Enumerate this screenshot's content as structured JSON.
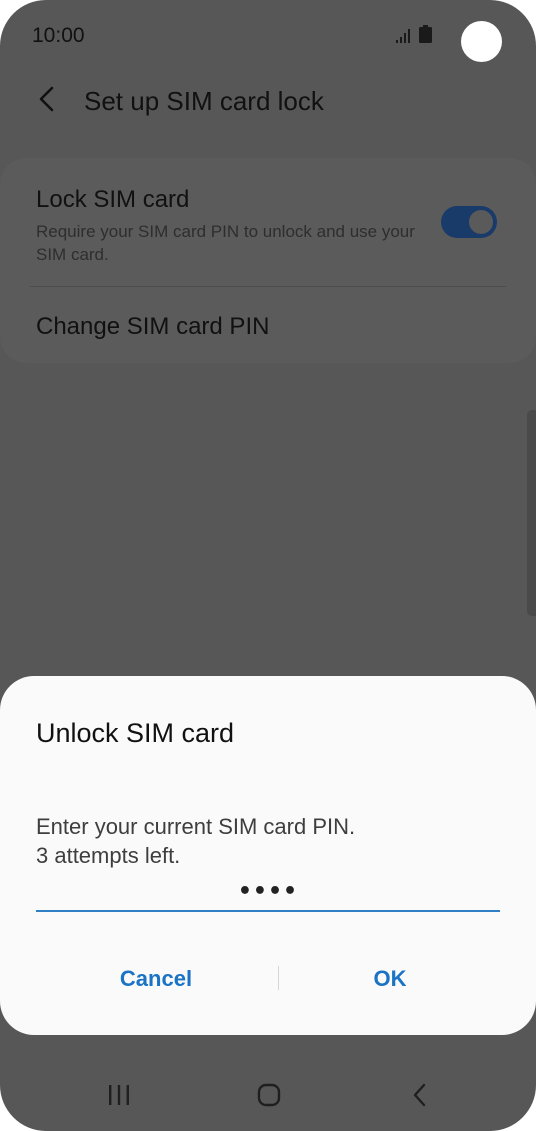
{
  "status_bar": {
    "time": "10:00"
  },
  "header": {
    "title": "Set up SIM card lock"
  },
  "settings": {
    "lock_sim": {
      "title": "Lock SIM card",
      "description": "Require your SIM card PIN to unlock and use your SIM card.",
      "enabled": true
    },
    "change_pin": {
      "label": "Change SIM card PIN"
    }
  },
  "dialog": {
    "title": "Unlock SIM card",
    "message_line1": "Enter your current SIM card PIN.",
    "message_line2": "3 attempts left.",
    "pin_value": "••••",
    "cancel_label": "Cancel",
    "ok_label": "OK"
  },
  "icons": {
    "back": "chevron-left-icon",
    "signal": "signal-icon",
    "battery": "battery-icon",
    "nav_recents": "recents-icon",
    "nav_home": "home-icon",
    "nav_back": "back-icon"
  },
  "colors": {
    "accent": "#1a73c4",
    "toggle_on": "#193b6a",
    "scrim_background": "#575757",
    "dialog_background": "#fafafa"
  }
}
